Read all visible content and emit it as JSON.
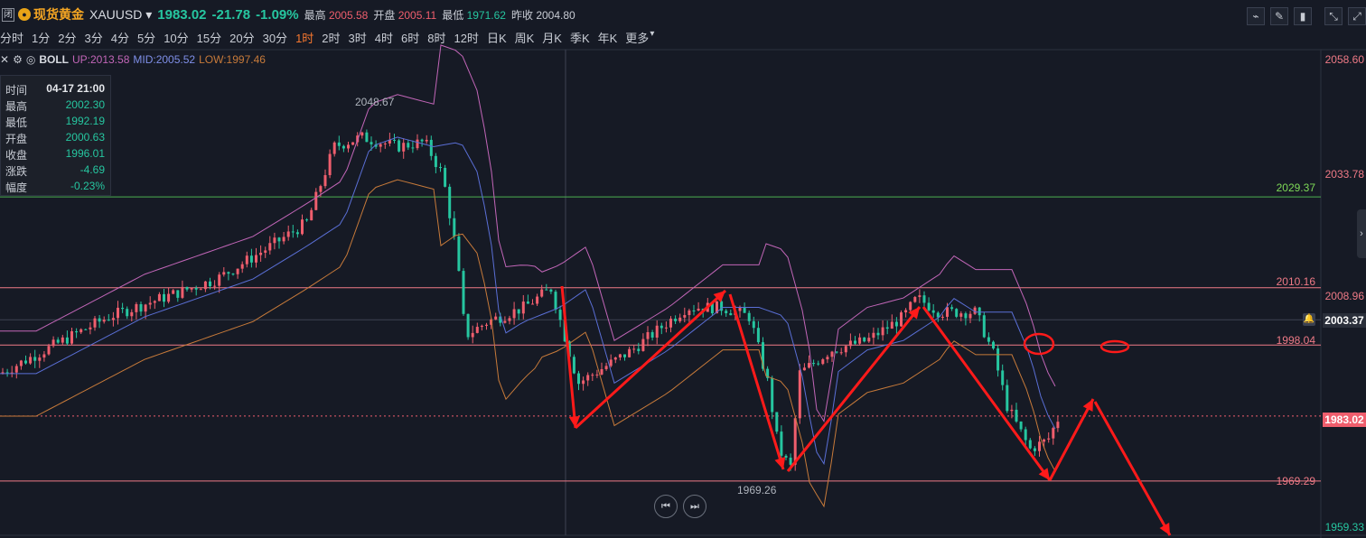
{
  "header": {
    "box_icon": "闭",
    "name": "现货黄金",
    "symbol": "XAUUSD",
    "price": "1983.02",
    "change": "-21.78",
    "change_pct": "-1.09%",
    "high_label": "最高",
    "high_value": "2005.58",
    "open_label": "开盘",
    "open_value": "2005.11",
    "low_label": "最低",
    "low_value": "1971.62",
    "prev_label": "昨收",
    "prev_value": "2004.80"
  },
  "tool_icons": [
    "line-chart-icon",
    "pencil-icon",
    "candlestick-icon",
    "collapse-icon",
    "expand-icon"
  ],
  "periods": [
    "分时",
    "1分",
    "2分",
    "3分",
    "4分",
    "5分",
    "10分",
    "15分",
    "20分",
    "30分",
    "1时",
    "2时",
    "3时",
    "4时",
    "6时",
    "8时",
    "12时",
    "日K",
    "周K",
    "月K",
    "季K",
    "年K",
    "更多"
  ],
  "active_period": "1时",
  "boll": {
    "name": "BOLL",
    "up": "UP:2013.58",
    "mid": "MID:2005.52",
    "low": "LOW:1997.46"
  },
  "info": {
    "rows": [
      {
        "label": "时间",
        "value": "04-17 21:00"
      },
      {
        "label": "最高",
        "value": "2002.30"
      },
      {
        "label": "最低",
        "value": "1992.19"
      },
      {
        "label": "开盘",
        "value": "2000.63"
      },
      {
        "label": "收盘",
        "value": "1996.01"
      },
      {
        "label": "涨跌",
        "value": "-4.69"
      },
      {
        "label": "幅度",
        "value": "-0.23%"
      }
    ]
  },
  "chart_data": {
    "type": "candlestick",
    "y_axis_ticks": [
      "2058.60",
      "2033.78",
      "2008.96",
      "1959.33"
    ],
    "ylim": [
      1959.33,
      2058.6
    ],
    "current_price": "1983.02",
    "crosshair_price": "2003.37",
    "horizontal_levels": [
      {
        "value": 2029.37,
        "label": "2029.37",
        "color": "#4caf50"
      },
      {
        "value": 2010.16,
        "label": "2010.16",
        "color": "#ef7a86"
      },
      {
        "value": 1998.04,
        "label": "1998.04",
        "color": "#ef7a86"
      },
      {
        "value": 1969.29,
        "label": "1969.29",
        "color": "#ef7a86"
      }
    ],
    "annotations": [
      {
        "text": "2048.67",
        "type": "max"
      },
      {
        "text": "1969.26",
        "type": "min"
      }
    ],
    "colors": {
      "up": "#ef5e6d",
      "down": "#26c6a0",
      "boll_up": "#c266b8",
      "boll_mid": "#5a6fd6",
      "boll_low": "#c77a3a",
      "arrow": "#ff1a1a"
    }
  }
}
